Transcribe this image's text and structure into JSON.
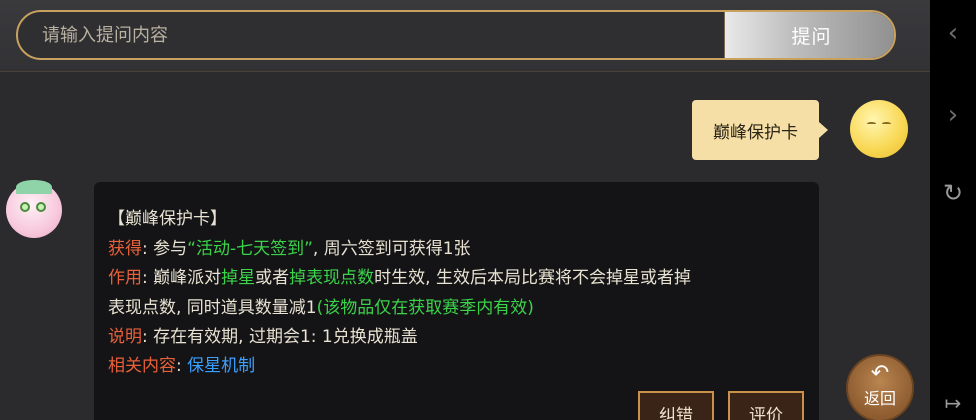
{
  "search": {
    "placeholder": "请输入提问内容",
    "submit_label": "提问"
  },
  "sidebar": {
    "icons": [
      "chevron-left-icon",
      "chevron-right-icon",
      "refresh-icon",
      "exit-icon"
    ]
  },
  "user_message": {
    "text": "巅峰保护卡"
  },
  "bot_message": {
    "title": "【巅峰保护卡】",
    "obtain_label": "获得",
    "obtain_pre": ": 参与",
    "obtain_quote": "“活动-七天签到”",
    "obtain_post": ", 周六签到可获得1张",
    "effect_label": "作用",
    "effect_pre": ": 巅峰派对",
    "effect_kw1": "掉星",
    "effect_mid": "或者",
    "effect_kw2": "掉表现点数",
    "effect_post": "时生效, 生效后本局比赛将不会掉星或者掉",
    "effect_line2_pre": "表现点数, 同时道具数量减1",
    "effect_line2_note": "(该物品仅在获取赛季内有效)",
    "desc_label": "说明",
    "desc_text": ": 存在有效期, 过期会1: 1兑换成瓶盖",
    "related_label": "相关内容",
    "related_sep": ": ",
    "related_link": "保星机制",
    "correct_button": "纠错",
    "rate_button": "评价"
  },
  "back_button": {
    "label": "返回"
  },
  "colors": {
    "accent_gold": "#c9a15f",
    "label_orange": "#e8613a",
    "keyword_green": "#3bd34a",
    "link_blue": "#3aa0ff",
    "user_bubble": "#f6dfa6"
  }
}
